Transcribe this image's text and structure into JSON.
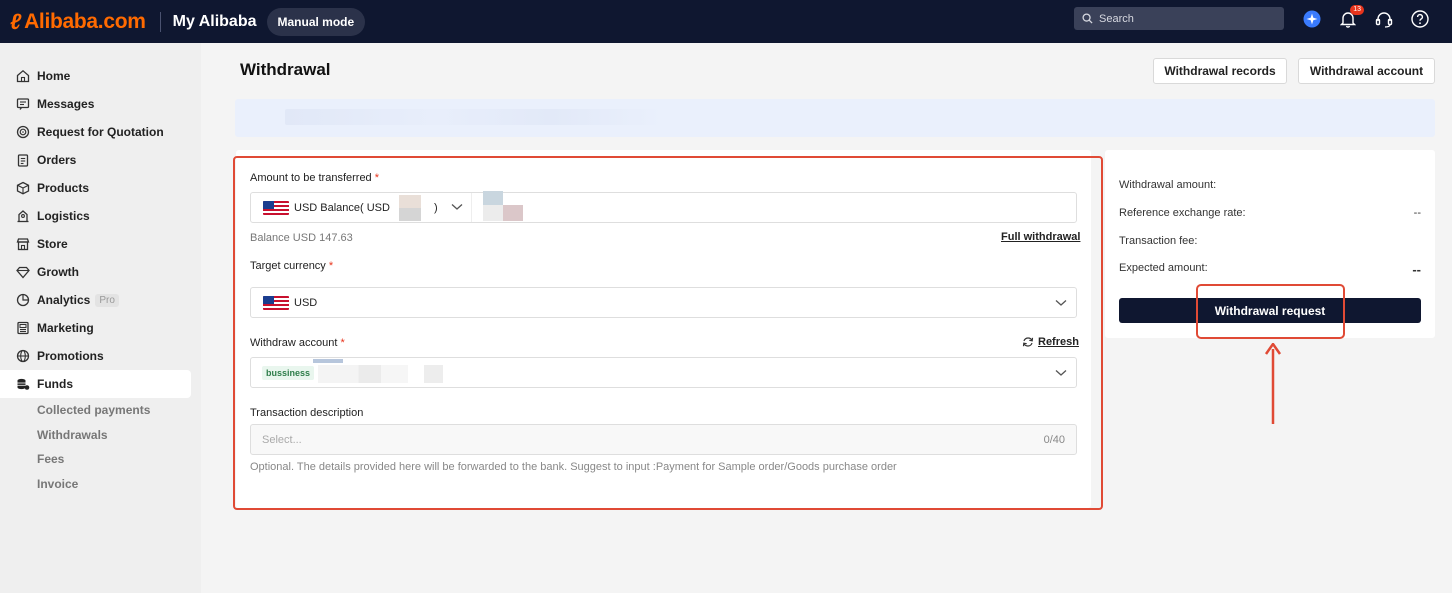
{
  "topbar": {
    "logo_text": "Alibaba.com",
    "brand": "My Alibaba",
    "mode": "Manual mode",
    "search_placeholder": "Search",
    "notification_count": "13",
    "icons": [
      "ai-assistant-icon",
      "bell-icon",
      "headset-icon",
      "help-icon"
    ]
  },
  "sidebar": {
    "items": [
      {
        "label": "Home",
        "icon": "home-icon"
      },
      {
        "label": "Messages",
        "icon": "message-icon"
      },
      {
        "label": "Request for Quotation",
        "icon": "target-icon"
      },
      {
        "label": "Orders",
        "icon": "clipboard-icon"
      },
      {
        "label": "Products",
        "icon": "box-icon"
      },
      {
        "label": "Logistics",
        "icon": "truck-icon"
      },
      {
        "label": "Store",
        "icon": "store-icon"
      },
      {
        "label": "Growth",
        "icon": "diamond-icon"
      },
      {
        "label": "Analytics",
        "icon": "chart-icon",
        "tag": "Pro"
      },
      {
        "label": "Marketing",
        "icon": "newspaper-icon"
      },
      {
        "label": "Promotions",
        "icon": "globe-icon"
      },
      {
        "label": "Funds",
        "icon": "coins-icon",
        "active": true
      }
    ],
    "funds_sub": [
      "Collected payments",
      "Withdrawals",
      "Fees",
      "Invoice"
    ]
  },
  "page": {
    "title": "Withdrawal",
    "records_button": "Withdrawal records",
    "account_button": "Withdrawal account"
  },
  "form": {
    "amount_label": "Amount to be transferred",
    "amount_currency_prefix": "USD",
    "amount_balance_label": "Balance( USD",
    "amount_balance_suffix": ")",
    "balance_text": "Balance USD 147.63",
    "full_withdrawal": "Full withdrawal",
    "target_label": "Target currency",
    "target_value": "USD",
    "account_label": "Withdraw account",
    "refresh": "Refresh",
    "account_tag": "bussiness",
    "desc_label": "Transaction description",
    "desc_placeholder": "Select...",
    "desc_count": "0/40",
    "helper": "Optional. The details provided here will be forwarded to the bank. Suggest to input :Payment for Sample order/Goods purchase order",
    "required_mark": "*"
  },
  "summary": {
    "withdrawal_amount_label": "Withdrawal amount:",
    "withdrawal_amount_value": "",
    "rate_label": "Reference exchange rate:",
    "rate_value": "--",
    "fee_label": "Transaction fee:",
    "fee_value": "",
    "expected_label": "Expected amount:",
    "expected_value": "--",
    "submit_button": "Withdrawal request"
  },
  "colors": {
    "topbar": "#0f1730",
    "brand_orange": "#ff6a00",
    "annotation_red": "#e04a35",
    "notice_bg": "#eaf0fc"
  }
}
